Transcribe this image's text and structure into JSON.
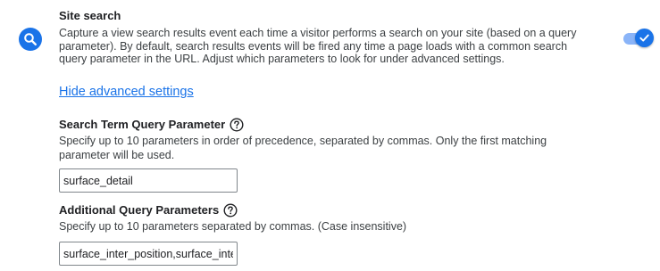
{
  "site_search": {
    "title": "Site search",
    "icon": "search-icon",
    "description": "Capture a view search results event each time a visitor performs a search on your site (based on a query parameter). By default, search results events will be fired any time a page loads with a common search query parameter in the URL. Adjust which parameters to look for under advanced settings.",
    "toggle_on": true
  },
  "advanced_link": "Hide advanced settings",
  "search_term_param": {
    "label": "Search Term Query Parameter",
    "help": "Specify up to 10 parameters in order of precedence, separated by commas. Only the first matching parameter will be used.",
    "value": "surface_detail"
  },
  "additional_params": {
    "label": "Additional Query Parameters",
    "help": "Specify up to 10 parameters separated by commas. (Case insensitive)",
    "value": "surface_inter_position,surface_inter_"
  },
  "colors": {
    "accent": "#1a73e8",
    "track": "#8ab4f8",
    "text": "#3c4043"
  }
}
